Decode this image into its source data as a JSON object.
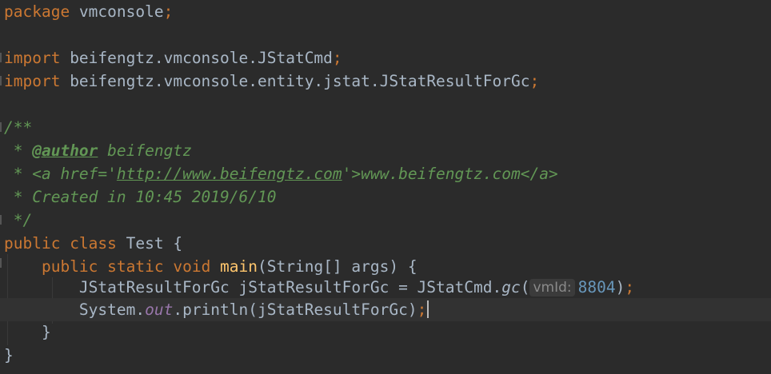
{
  "code": {
    "l1": {
      "kw": "package",
      "name": " vmconsole",
      "semi": ";"
    },
    "l3": {
      "kw": "import",
      "path": " beifengtz.vmconsole.JStatCmd",
      "semi": ";"
    },
    "l4": {
      "kw": "import",
      "path": " beifengtz.vmconsole.entity.jstat.JStatResultForGc",
      "semi": ";"
    },
    "l6": {
      "text": "/**"
    },
    "l7": {
      "prefix": " * ",
      "tag": "@author",
      "rest": " beifengtz"
    },
    "l8": {
      "prefix": " * <a href='",
      "url": "http://www.beifengtz.com",
      "suffix": "'>www.beifengtz.com</a>"
    },
    "l9": {
      "text": " * Created in 10:45 2019/6/10"
    },
    "l10": {
      "text": " */"
    },
    "l11": {
      "kw1": "public",
      "kw2": " class",
      "name": " Test {"
    },
    "l12": {
      "indent": "    ",
      "kw1": "public",
      "kw2": " static",
      "kw3": " void",
      "fn": " main",
      "rest": "(String[] args) {"
    },
    "l13": {
      "indent": "        ",
      "a": "JStatResultForGc jStatResultForGc = JStatCmd.",
      "call": "gc",
      "open": "(",
      "hint": "vmId:",
      "num": "8804",
      "close": ")",
      "semi": ";"
    },
    "l14": {
      "indent": "        ",
      "a": "System.",
      "field": "out",
      "b": ".println(jStatResultForGc)",
      "semi": ";"
    },
    "l15": {
      "text": "    }"
    },
    "l16": {
      "text": "}"
    }
  }
}
